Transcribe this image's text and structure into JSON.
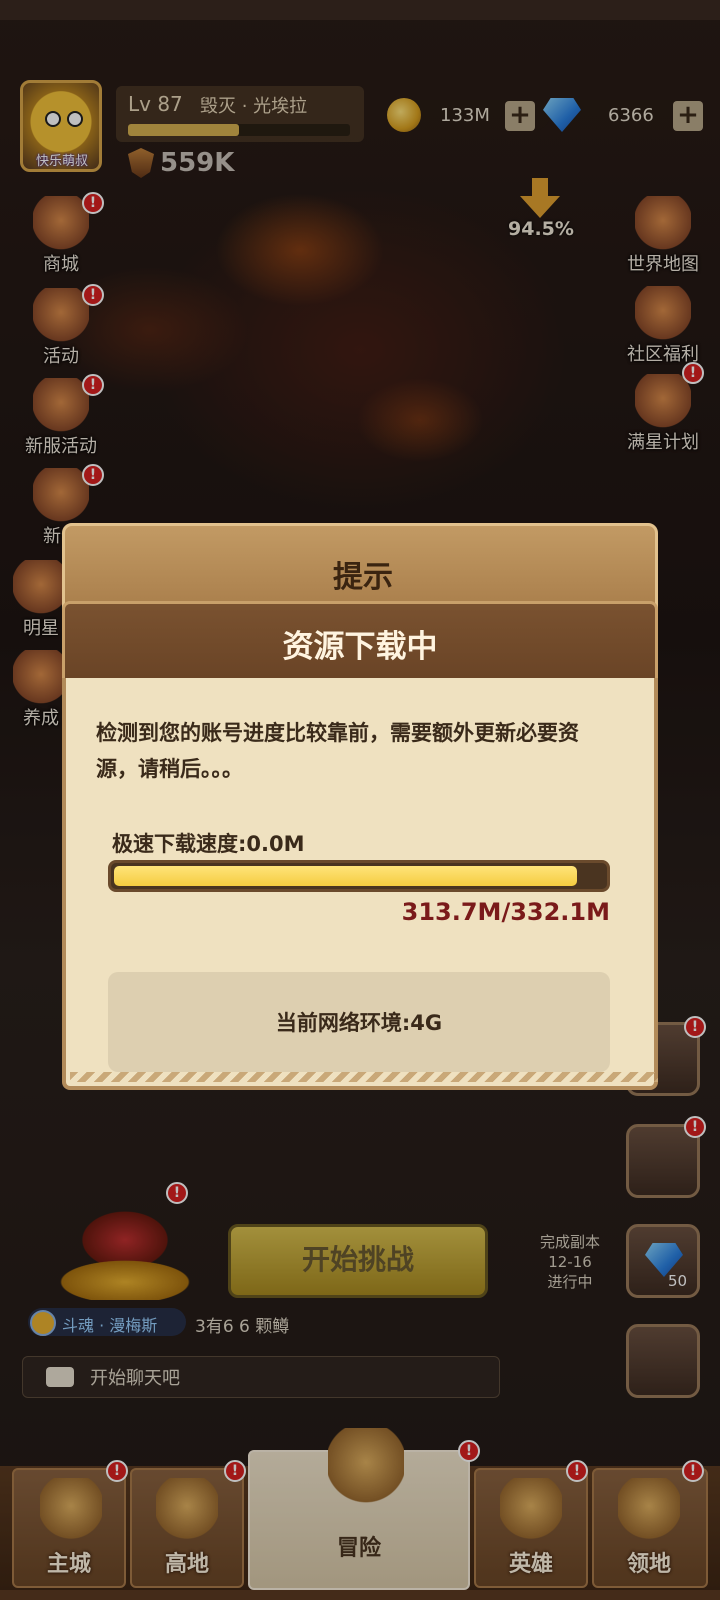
{
  "header": {
    "avatar_name": "快乐萌叔",
    "level": "Lv 87",
    "player_name": "毁灭 · 光埃拉",
    "xp_progress": 0.5,
    "power": "559K",
    "gold": "133M",
    "gems": "6366"
  },
  "left_menu": [
    {
      "label": "商城"
    },
    {
      "label": "活动"
    },
    {
      "label": "新服活动"
    },
    {
      "label": "新卡"
    },
    {
      "label": "明星"
    },
    {
      "label": "养成"
    }
  ],
  "right_menu": [
    {
      "label": "世界地图"
    },
    {
      "label": "社区福利"
    },
    {
      "label": "满星计划"
    }
  ],
  "download_percent": "94.5%",
  "dialog": {
    "title": "提示",
    "subtitle": "资源下载中",
    "message": "检测到您的账号进度比较靠前，需要额外更新必要资源，请稍后。。。",
    "speed_label": "极速下载速度:0.0M",
    "progress_fraction": 0.945,
    "progress_text": "313.7M/332.1M",
    "network_text": "当前网络环境:4G"
  },
  "challenge_button": "开始挑战",
  "dungeon": {
    "line1": "完成副本",
    "line2": "12-16",
    "line3": "进行中"
  },
  "gem_reward_count": "50",
  "chat": {
    "sender": "斗魂 · 漫梅斯",
    "message": "3有6 6 颗鳟",
    "placeholder": "开始聊天吧"
  },
  "nav": {
    "tabs": [
      {
        "label": "主城"
      },
      {
        "label": "高地"
      },
      {
        "label": "冒险"
      },
      {
        "label": "英雄"
      },
      {
        "label": "领地"
      }
    ]
  },
  "colors": {
    "dialog_bg": "#efe1c0",
    "progress_fill": "#f5cc40",
    "progress_text": "#7a1a1a",
    "badge_red": "#d92020"
  }
}
